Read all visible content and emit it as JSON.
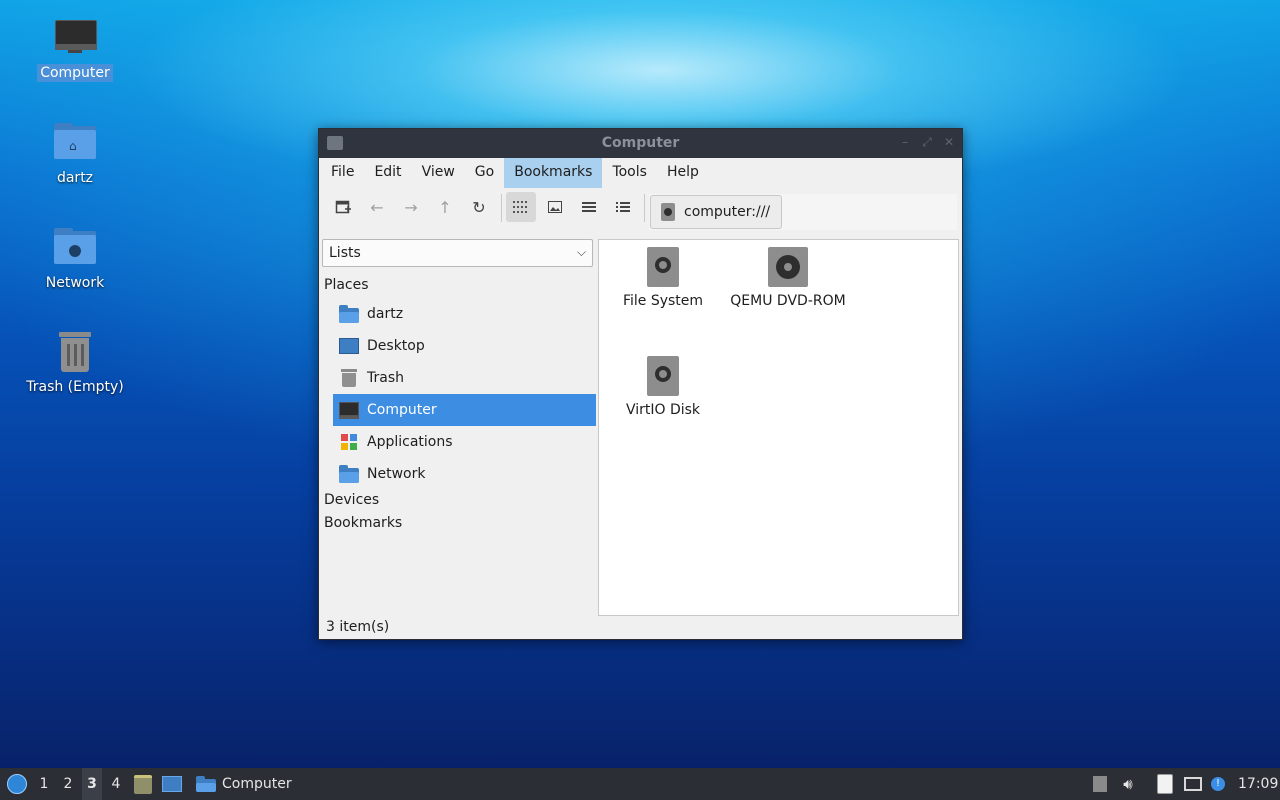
{
  "desktop": {
    "icons": [
      {
        "label": "Computer",
        "icon": "computer-icon",
        "selected": true
      },
      {
        "label": "dartz",
        "icon": "home-folder-icon"
      },
      {
        "label": "Network",
        "icon": "network-folder-icon"
      },
      {
        "label": "Trash (Empty)",
        "icon": "trash-icon"
      }
    ]
  },
  "window": {
    "title": "Computer",
    "menu": [
      "File",
      "Edit",
      "View",
      "Go",
      "Bookmarks",
      "Tools",
      "Help"
    ],
    "active_menu": "Bookmarks",
    "location": "computer:///",
    "sidebar": {
      "mode": "Lists",
      "places_heading": "Places",
      "places": [
        {
          "label": "dartz",
          "icon": "home-folder-icon"
        },
        {
          "label": "Desktop",
          "icon": "desktop-icon"
        },
        {
          "label": "Trash",
          "icon": "trash-icon"
        },
        {
          "label": "Computer",
          "icon": "computer-icon",
          "selected": true
        },
        {
          "label": "Applications",
          "icon": "applications-icon"
        },
        {
          "label": "Network",
          "icon": "network-folder-icon"
        }
      ],
      "devices_heading": "Devices",
      "bookmarks_heading": "Bookmarks"
    },
    "items": [
      {
        "label": "File System",
        "icon": "harddisk-icon"
      },
      {
        "label": "QEMU DVD-ROM",
        "icon": "dvd-icon"
      },
      {
        "label": "VirtIO Disk",
        "icon": "harddisk-icon"
      }
    ],
    "status": "3 item(s)"
  },
  "taskbar": {
    "workspaces": [
      "1",
      "2",
      "3",
      "4"
    ],
    "active_workspace": "3",
    "task_label": "Computer",
    "clock": "17:09"
  },
  "colors": {
    "selection": "#3d8ee3",
    "menu_highlight": "#a9d0ef",
    "titlebar": "#2f343f",
    "taskbar": "#2b2e34"
  }
}
